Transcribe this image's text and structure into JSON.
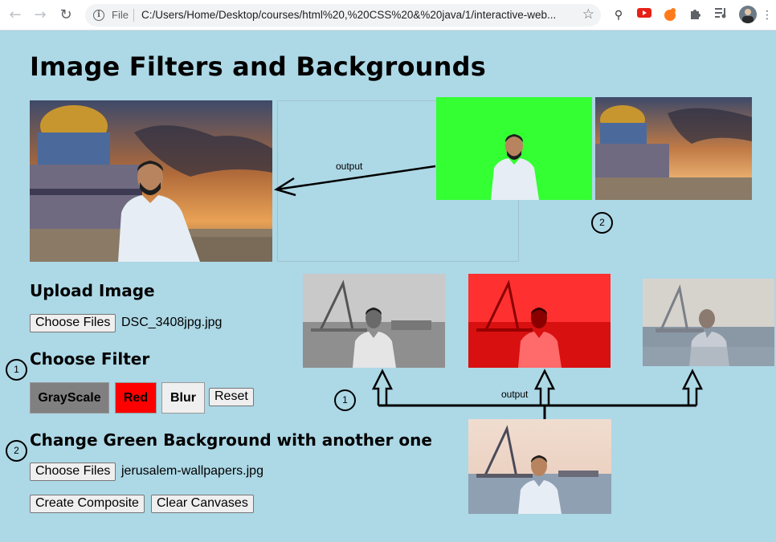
{
  "browser": {
    "back_icon": "back-arrow-icon",
    "forward_icon": "forward-arrow-icon",
    "reload_icon": "reload-icon",
    "url_scheme": "File",
    "url": "C:/Users/Home/Desktop/courses/html%20,%20CSS%20&%20java/1/interactive-web..."
  },
  "page": {
    "title": "Image Filters and Backgrounds"
  },
  "upload": {
    "heading": "Upload Image",
    "choose_label": "Choose Files",
    "file_name": "DSC_3408jpg.jpg"
  },
  "filter": {
    "heading": "Choose Filter",
    "grayscale_label": "GrayScale",
    "red_label": "Red",
    "blur_label": "Blur",
    "reset_label": "Reset",
    "colors": {
      "grayscale": "#808080",
      "red": "#ff0000",
      "blur": "#efefef"
    }
  },
  "background": {
    "heading": "Change Green Background with another one",
    "choose_label": "Choose Files",
    "file_name": "jerusalem-wallpapers.jpg",
    "composite_label": "Create Composite",
    "clear_label": "Clear Canvases"
  },
  "annotations": {
    "output_top": "output",
    "output_bottom": "output",
    "marker_1a": "1",
    "marker_1b": "1",
    "marker_2a": "2",
    "marker_2b": "2"
  },
  "colors": {
    "page_background": "#add8e6",
    "green_screen": "#33ff33"
  }
}
